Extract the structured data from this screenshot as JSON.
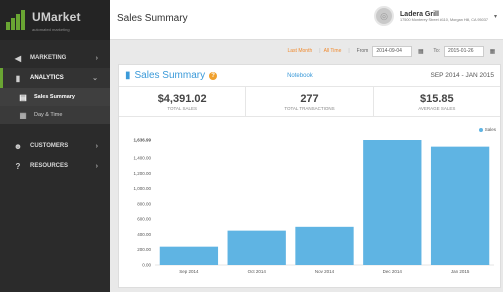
{
  "brand": {
    "name": "UMarket",
    "tagline": "automated marketing",
    "accent": "#6aa533"
  },
  "sidebar": {
    "items": [
      {
        "label": "MARKETING",
        "icon": "megaphone-icon"
      },
      {
        "label": "ANALYTICS",
        "icon": "bar-chart-icon",
        "active": true,
        "sub": [
          {
            "label": "Sales Summary",
            "icon": "sales-chart-icon",
            "active": true
          },
          {
            "label": "Day & Time",
            "icon": "calendar-icon"
          }
        ]
      },
      {
        "label": "CUSTOMERS",
        "icon": "people-icon"
      },
      {
        "label": "RESOURCES",
        "icon": "question-icon"
      }
    ]
  },
  "header": {
    "title": "Sales Summary",
    "account_name": "Ladera Grill",
    "account_address": "17500 Monterey Street #110, Morgan Hill, CA 95037"
  },
  "filter": {
    "last_month": "Last Month",
    "all_time": "All Time",
    "from_label": "From",
    "from_value": "2014-09-04",
    "to_label": "To:",
    "to_value": "2015-01-26"
  },
  "panel": {
    "title": "Sales Summary",
    "notebook_link": "Notebook",
    "range": "SEP 2014 - JAN 2015",
    "stats": [
      {
        "value": "$4,391.02",
        "label": "TOTAL SALES"
      },
      {
        "value": "277",
        "label": "TOTAL TRANSACTIONS"
      },
      {
        "value": "$15.85",
        "label": "AVERAGE SALES"
      }
    ]
  },
  "colors": {
    "bar": "#5fb4e3",
    "link": "#3b9ad9",
    "orange": "#f08a2e"
  },
  "chart_data": {
    "type": "bar",
    "categories": [
      "Sep 2014",
      "Oct 2014",
      "Nov 2014",
      "Dec 2014",
      "Jan 2015"
    ],
    "series": [
      {
        "name": "Sales",
        "values": [
          240,
          450,
          500,
          1636.99,
          1550
        ]
      }
    ],
    "yticks": [
      "0.00",
      "200.00",
      "400.00",
      "600.00",
      "800.00",
      "1,000.00",
      "1,200.00",
      "1,400.00",
      "1,636.99"
    ],
    "ylim": [
      0,
      1636.99
    ],
    "legend": "top-right",
    "grid": false
  }
}
